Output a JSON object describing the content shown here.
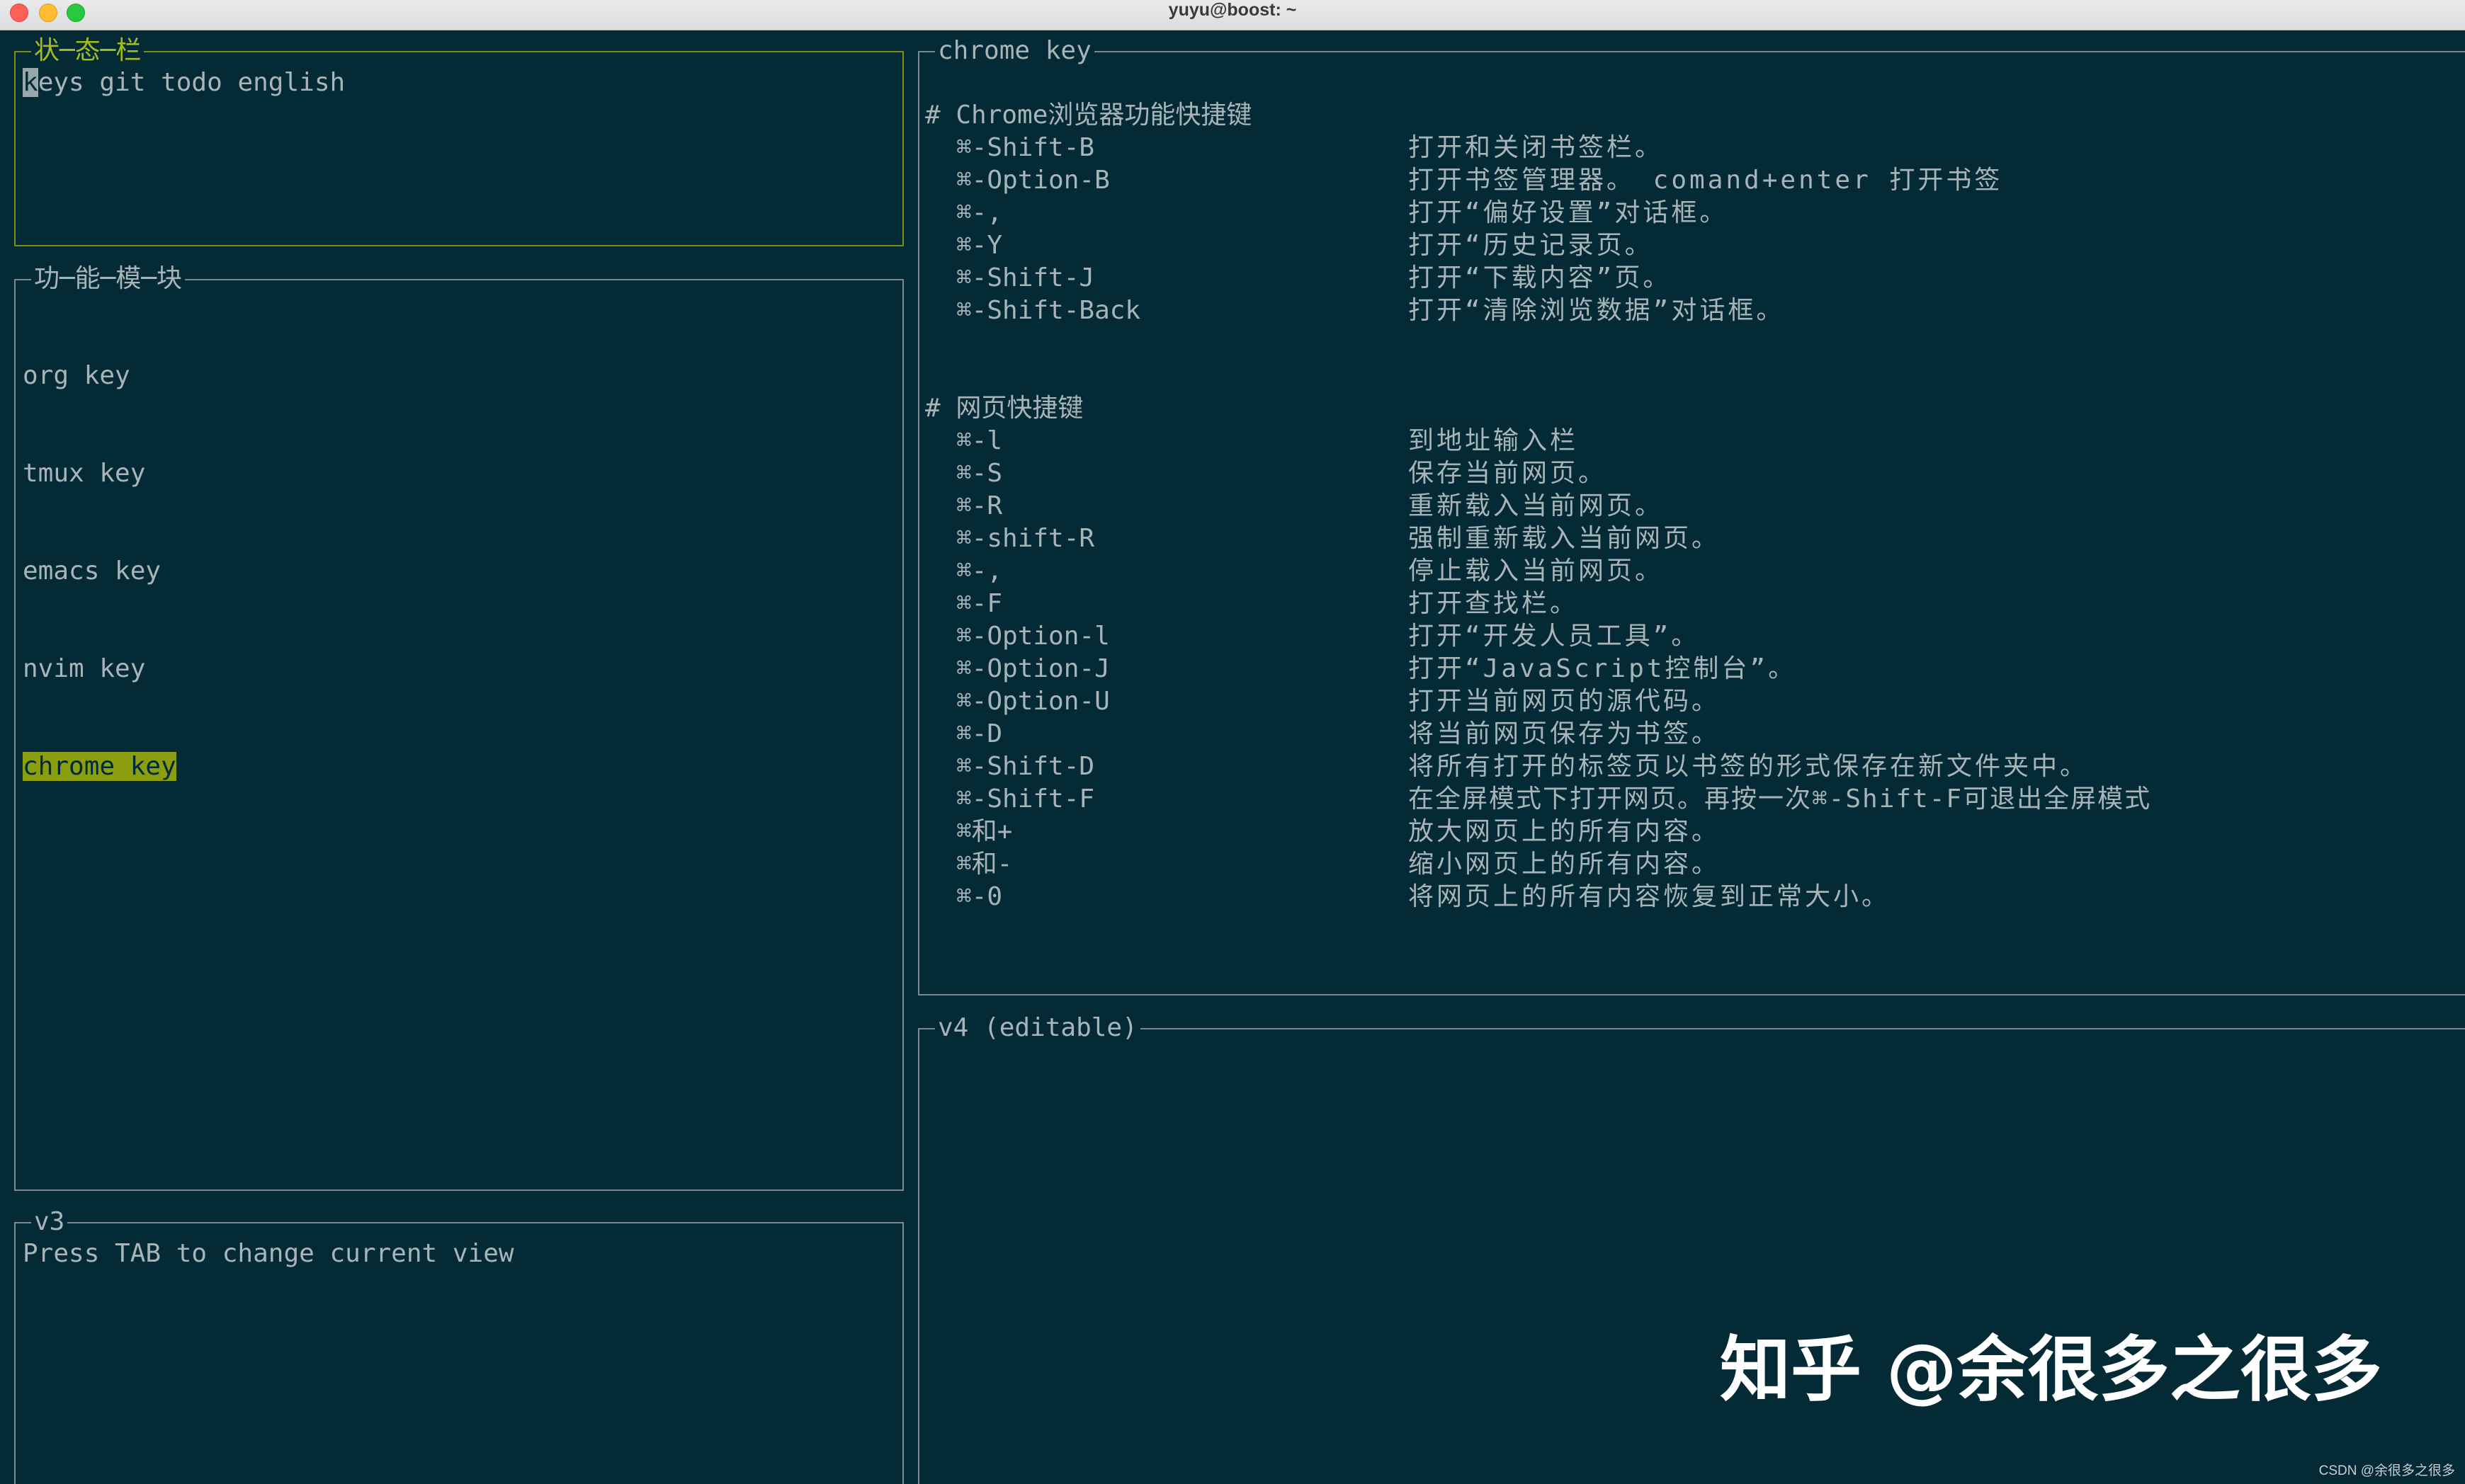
{
  "window": {
    "title": "yuyu@boost: ~"
  },
  "status_panel": {
    "title": "状─态─栏",
    "line_cursor_char": "k",
    "line_rest": "eys git todo english"
  },
  "module_panel": {
    "title": "功─能─模─块",
    "items": [
      "org key",
      "tmux key",
      "emacs key",
      "nvim key",
      "chrome key"
    ],
    "selected_index": 4
  },
  "v3_panel": {
    "title": "v3",
    "text": "Press TAB to change current view"
  },
  "chrome_panel": {
    "title": "chrome key",
    "section1_heading": "# Chrome浏览器功能快捷键",
    "section1": [
      {
        "key": "⌘-Shift-B",
        "desc": "打开和关闭书签栏。"
      },
      {
        "key": "⌘-Option-B",
        "desc": "打开书签管理器。 comand+enter 打开书签"
      },
      {
        "key": "⌘-,",
        "desc": "打开“偏好设置”对话框。"
      },
      {
        "key": "⌘-Y",
        "desc": "打开“历史记录页。"
      },
      {
        "key": "⌘-Shift-J",
        "desc": "打开“下载内容”页。"
      },
      {
        "key": "⌘-Shift-Back",
        "desc": "打开“清除浏览数据”对话框。"
      }
    ],
    "section2_heading": "# 网页快捷键",
    "section2": [
      {
        "key": "⌘-l",
        "desc": "到地址输入栏"
      },
      {
        "key": "⌘-S",
        "desc": "保存当前网页。"
      },
      {
        "key": "⌘-R",
        "desc": "重新载入当前网页。"
      },
      {
        "key": "⌘-shift-R",
        "desc": "强制重新载入当前网页。"
      },
      {
        "key": "⌘-,",
        "desc": "停止载入当前网页。"
      },
      {
        "key": "⌘-F",
        "desc": "打开查找栏。"
      },
      {
        "key": "⌘-Option-l",
        "desc": "打开“开发人员工具”。"
      },
      {
        "key": "⌘-Option-J",
        "desc": "打开“JavaScript控制台”。"
      },
      {
        "key": "⌘-Option-U",
        "desc": "打开当前网页的源代码。"
      },
      {
        "key": "⌘-D",
        "desc": "将当前网页保存为书签。"
      },
      {
        "key": "⌘-Shift-D",
        "desc": "将所有打开的标签页以书签的形式保存在新文件夹中。"
      },
      {
        "key": "⌘-Shift-F",
        "desc": "在全屏模式下打开网页。再按一次⌘-Shift-F可退出全屏模式"
      },
      {
        "key": "⌘和+",
        "desc": "放大网页上的所有内容。"
      },
      {
        "key": "⌘和-",
        "desc": "缩小网页上的所有内容。"
      },
      {
        "key": "⌘-0",
        "desc": "将网页上的所有内容恢复到正常大小。"
      }
    ]
  },
  "v4_panel": {
    "title": "v4 (editable)"
  },
  "watermark": {
    "zhihu": "知乎 @余很多之很多",
    "csdn": "CSDN @余很多之很多"
  }
}
